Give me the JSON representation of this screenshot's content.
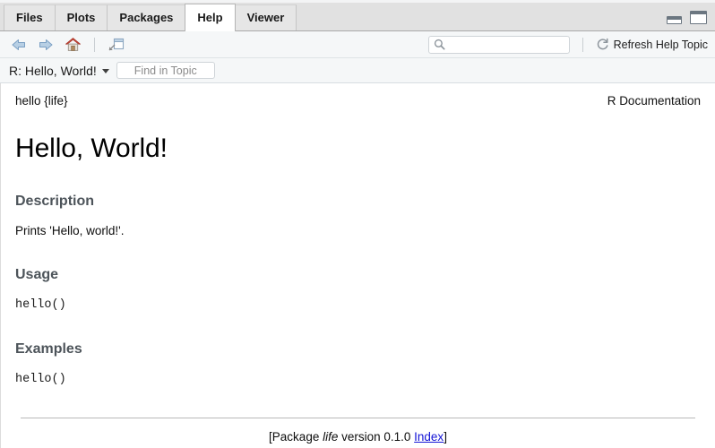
{
  "pane": {
    "tabs": [
      {
        "label": "Files",
        "active": false
      },
      {
        "label": "Plots",
        "active": false
      },
      {
        "label": "Packages",
        "active": false
      },
      {
        "label": "Help",
        "active": true
      },
      {
        "label": "Viewer",
        "active": false
      }
    ],
    "window_controls": {
      "minimize_name": "minimize-pane-button",
      "maximize_name": "maximize-pane-button"
    }
  },
  "toolbar": {
    "back_icon": "back-arrow-icon",
    "forward_icon": "forward-arrow-icon",
    "home_icon": "home-icon",
    "new_window_icon": "show-in-new-window-icon",
    "search": {
      "icon": "search-icon",
      "value": "",
      "placeholder": ""
    },
    "refresh": {
      "icon": "refresh-icon",
      "label": "Refresh Help Topic"
    }
  },
  "topicbar": {
    "topic_label": "R: Hello, World!",
    "dropdown_icon": "chevron-down-icon",
    "find_placeholder": "Find in Topic",
    "find_value": ""
  },
  "document": {
    "topic_id": "hello {life}",
    "doc_type": "R Documentation",
    "title": "Hello, World!",
    "sections": [
      {
        "heading": "Description",
        "kind": "text",
        "content": "Prints 'Hello, world!'."
      },
      {
        "heading": "Usage",
        "kind": "code",
        "content": "hello()"
      },
      {
        "heading": "Examples",
        "kind": "code",
        "content": "hello()"
      }
    ],
    "footer": {
      "prefix": "[Package ",
      "package": "life",
      "middle": " version 0.1.0 ",
      "link": "Index",
      "suffix": "]"
    }
  },
  "colors": {
    "tab_active_bg": "#ffffff",
    "tabbar_bg": "#e1e1e1",
    "toolbar_bg": "#f5f7f8",
    "section_heading": "#4d545a",
    "link": "#1414d6",
    "home_roof": "#c0392b"
  }
}
